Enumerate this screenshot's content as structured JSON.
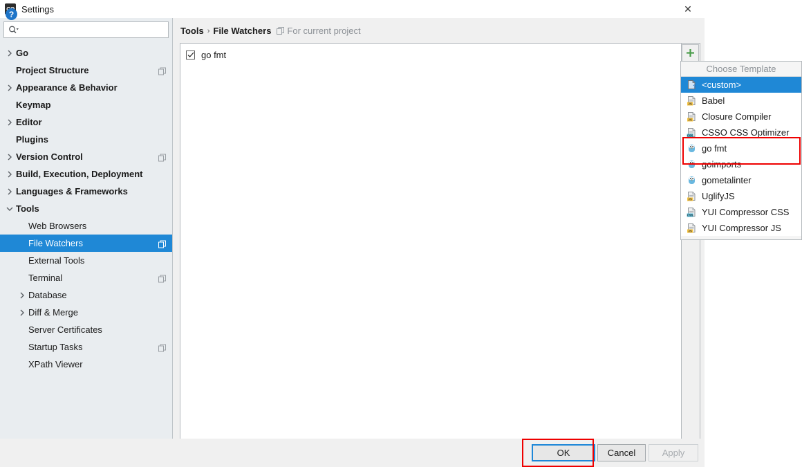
{
  "window": {
    "title": "Settings",
    "app_icon": "go-logo-icon",
    "close_label": "✕"
  },
  "search": {
    "value": "",
    "placeholder": "",
    "icon": "search-icon"
  },
  "sidebar": {
    "items": [
      {
        "label": "Go",
        "level": 0,
        "bold": true,
        "arrow": "collapsed",
        "badge": false,
        "selected": false
      },
      {
        "label": "Project Structure",
        "level": 0,
        "bold": true,
        "arrow": "none",
        "badge": true,
        "selected": false
      },
      {
        "label": "Appearance & Behavior",
        "level": 0,
        "bold": true,
        "arrow": "collapsed",
        "badge": false,
        "selected": false
      },
      {
        "label": "Keymap",
        "level": 0,
        "bold": true,
        "arrow": "none",
        "badge": false,
        "selected": false
      },
      {
        "label": "Editor",
        "level": 0,
        "bold": true,
        "arrow": "collapsed",
        "badge": false,
        "selected": false
      },
      {
        "label": "Plugins",
        "level": 0,
        "bold": true,
        "arrow": "none",
        "badge": false,
        "selected": false
      },
      {
        "label": "Version Control",
        "level": 0,
        "bold": true,
        "arrow": "collapsed",
        "badge": true,
        "selected": false
      },
      {
        "label": "Build, Execution, Deployment",
        "level": 0,
        "bold": true,
        "arrow": "collapsed",
        "badge": false,
        "selected": false
      },
      {
        "label": "Languages & Frameworks",
        "level": 0,
        "bold": true,
        "arrow": "collapsed",
        "badge": false,
        "selected": false
      },
      {
        "label": "Tools",
        "level": 0,
        "bold": true,
        "arrow": "expanded",
        "badge": false,
        "selected": false
      },
      {
        "label": "Web Browsers",
        "level": 1,
        "bold": false,
        "arrow": "none",
        "badge": false,
        "selected": false
      },
      {
        "label": "File Watchers",
        "level": 1,
        "bold": false,
        "arrow": "none",
        "badge": true,
        "selected": true
      },
      {
        "label": "External Tools",
        "level": 1,
        "bold": false,
        "arrow": "none",
        "badge": false,
        "selected": false
      },
      {
        "label": "Terminal",
        "level": 1,
        "bold": false,
        "arrow": "none",
        "badge": true,
        "selected": false
      },
      {
        "label": "Database",
        "level": 1,
        "bold": false,
        "arrow": "collapsed",
        "badge": false,
        "selected": false
      },
      {
        "label": "Diff & Merge",
        "level": 1,
        "bold": false,
        "arrow": "collapsed",
        "badge": false,
        "selected": false
      },
      {
        "label": "Server Certificates",
        "level": 1,
        "bold": false,
        "arrow": "none",
        "badge": false,
        "selected": false
      },
      {
        "label": "Startup Tasks",
        "level": 1,
        "bold": false,
        "arrow": "none",
        "badge": true,
        "selected": false
      },
      {
        "label": "XPath Viewer",
        "level": 1,
        "bold": false,
        "arrow": "none",
        "badge": false,
        "selected": false
      }
    ]
  },
  "breadcrumb": {
    "parent": "Tools",
    "separator": "›",
    "current": "File Watchers",
    "scope": "For current project",
    "scope_icon": "project-scope-icon"
  },
  "watchers": {
    "rows": [
      {
        "label": "go fmt",
        "checked": true
      }
    ],
    "add_button_icon": "plus-icon",
    "add_button_label": "+"
  },
  "popup": {
    "header": "Choose Template",
    "items": [
      {
        "label": "<custom>",
        "icon": "custom-template-icon",
        "selected": true
      },
      {
        "label": "Babel",
        "icon": "js-file-icon",
        "selected": false
      },
      {
        "label": "Closure Compiler",
        "icon": "js-file-icon",
        "selected": false
      },
      {
        "label": "CSSO CSS Optimizer",
        "icon": "css-file-icon",
        "selected": false
      },
      {
        "label": "go fmt",
        "icon": "go-gopher-icon",
        "selected": false
      },
      {
        "label": "goimports",
        "icon": "go-gopher-icon",
        "selected": false
      },
      {
        "label": "gometalinter",
        "icon": "go-gopher-icon",
        "selected": false
      },
      {
        "label": "UglifyJS",
        "icon": "js-file-icon",
        "selected": false
      },
      {
        "label": "YUI Compressor CSS",
        "icon": "css-file-icon",
        "selected": false
      },
      {
        "label": "YUI Compressor JS",
        "icon": "js-file-icon",
        "selected": false
      }
    ]
  },
  "footer": {
    "help_icon": "help-icon",
    "help_label": "?",
    "ok_label": "OK",
    "cancel_label": "Cancel",
    "apply_label": "Apply"
  },
  "colors": {
    "accent_blue": "#1f88d6",
    "annotation_red": "#ee0000",
    "plus_green": "#4a9c4a",
    "dialog_border": "#1d7fd0"
  }
}
